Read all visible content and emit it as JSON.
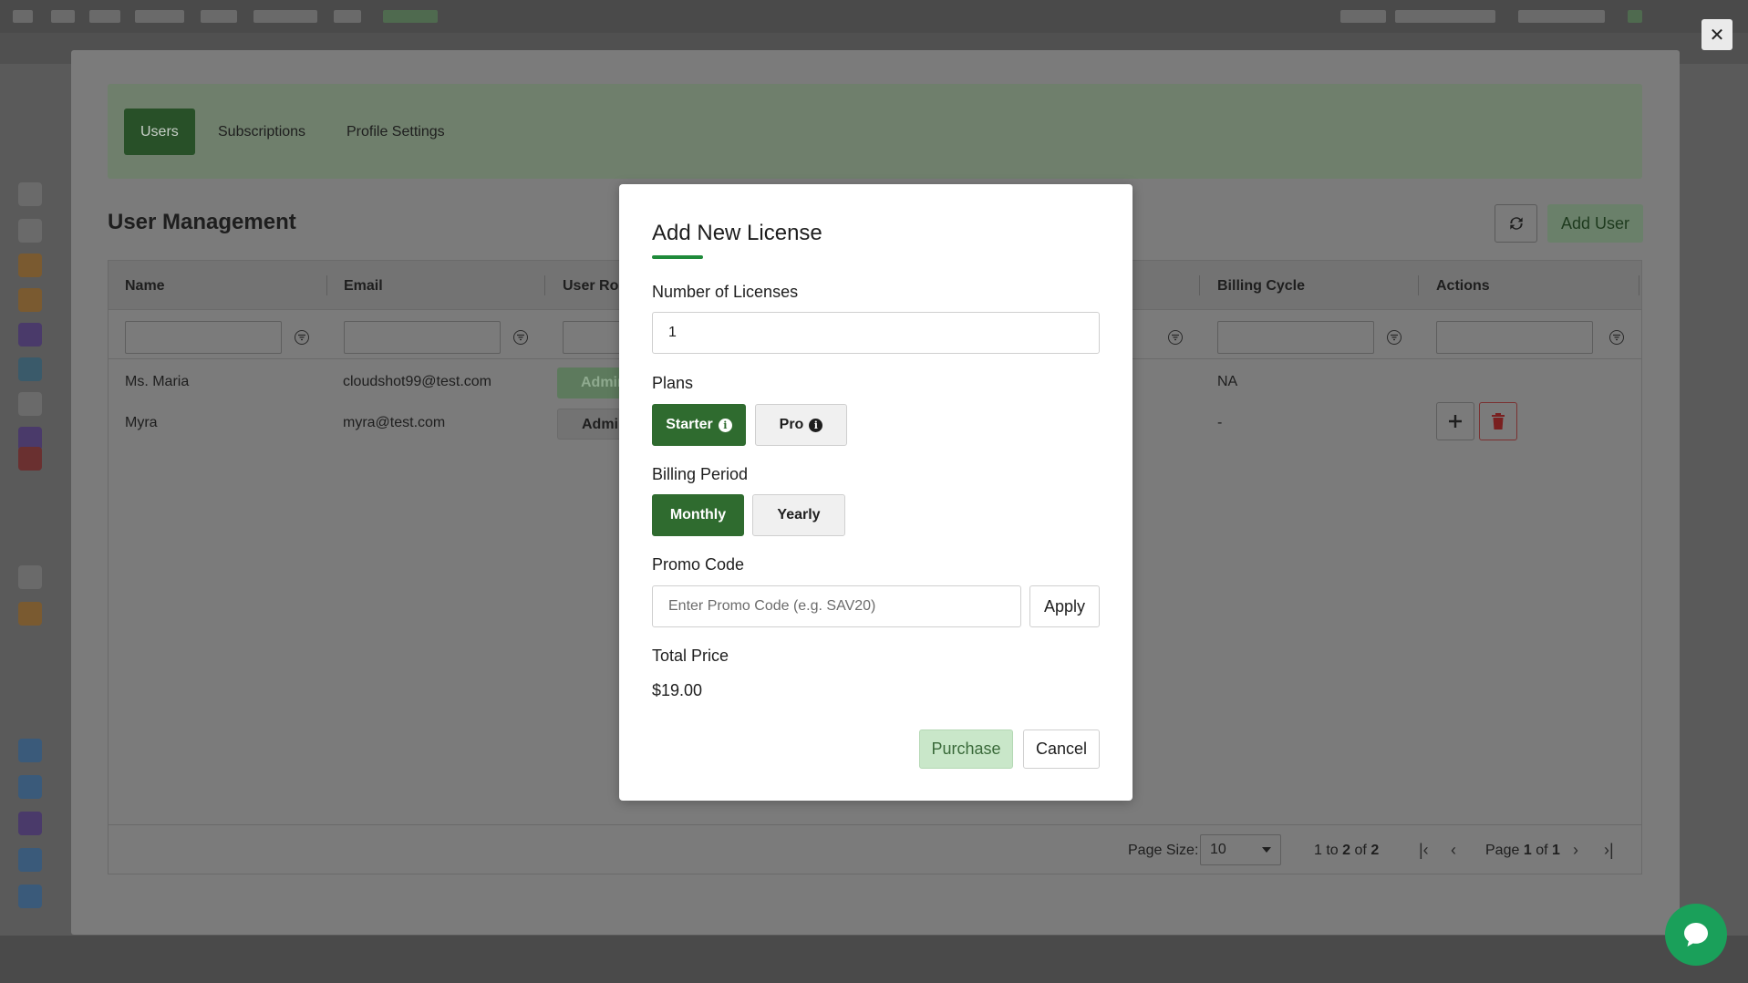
{
  "tabs": [
    {
      "label": "Users",
      "active": true
    },
    {
      "label": "Subscriptions",
      "active": false
    },
    {
      "label": "Profile Settings",
      "active": false
    }
  ],
  "section_title": "User Management",
  "add_user_label": "Add User",
  "grid": {
    "columns": [
      "Name",
      "Email",
      "User Role",
      "Billing Cycle",
      "Actions"
    ],
    "rows": [
      {
        "name": "Ms. Maria",
        "email": "cloudshot99@test.com",
        "role": "Admin",
        "billing_cycle": "NA"
      },
      {
        "name": "Myra",
        "email": "myra@test.com",
        "role": "Admin",
        "billing_cycle": "-"
      }
    ],
    "footer": {
      "page_size_label": "Page Size:",
      "page_size_value": "10",
      "range_prefix": "1",
      "range_to": "to",
      "range_end": "2",
      "range_of": "of",
      "range_total": "2",
      "page_word": "Page",
      "page_current": "1",
      "page_of": "of",
      "page_total": "1"
    }
  },
  "modal": {
    "title": "Add New License",
    "licenses_label": "Number of Licenses",
    "licenses_value": "1",
    "plans_label": "Plans",
    "plans": [
      {
        "label": "Starter",
        "active": true
      },
      {
        "label": "Pro",
        "active": false
      }
    ],
    "billing_label": "Billing Period",
    "billing_options": [
      {
        "label": "Monthly",
        "active": true
      },
      {
        "label": "Yearly",
        "active": false
      }
    ],
    "promo_label": "Promo Code",
    "promo_placeholder": "Enter Promo Code (e.g. SAV20)",
    "apply_label": "Apply",
    "total_label": "Total Price",
    "total_value": "$19.00",
    "purchase_label": "Purchase",
    "cancel_label": "Cancel"
  },
  "colors": {
    "primary_green": "#2f6b2f",
    "accent_underline": "#1e8a3a",
    "purchase_bg": "#c9e7c9",
    "delete_red": "#c62828",
    "chat_green": "#1aa05a"
  }
}
